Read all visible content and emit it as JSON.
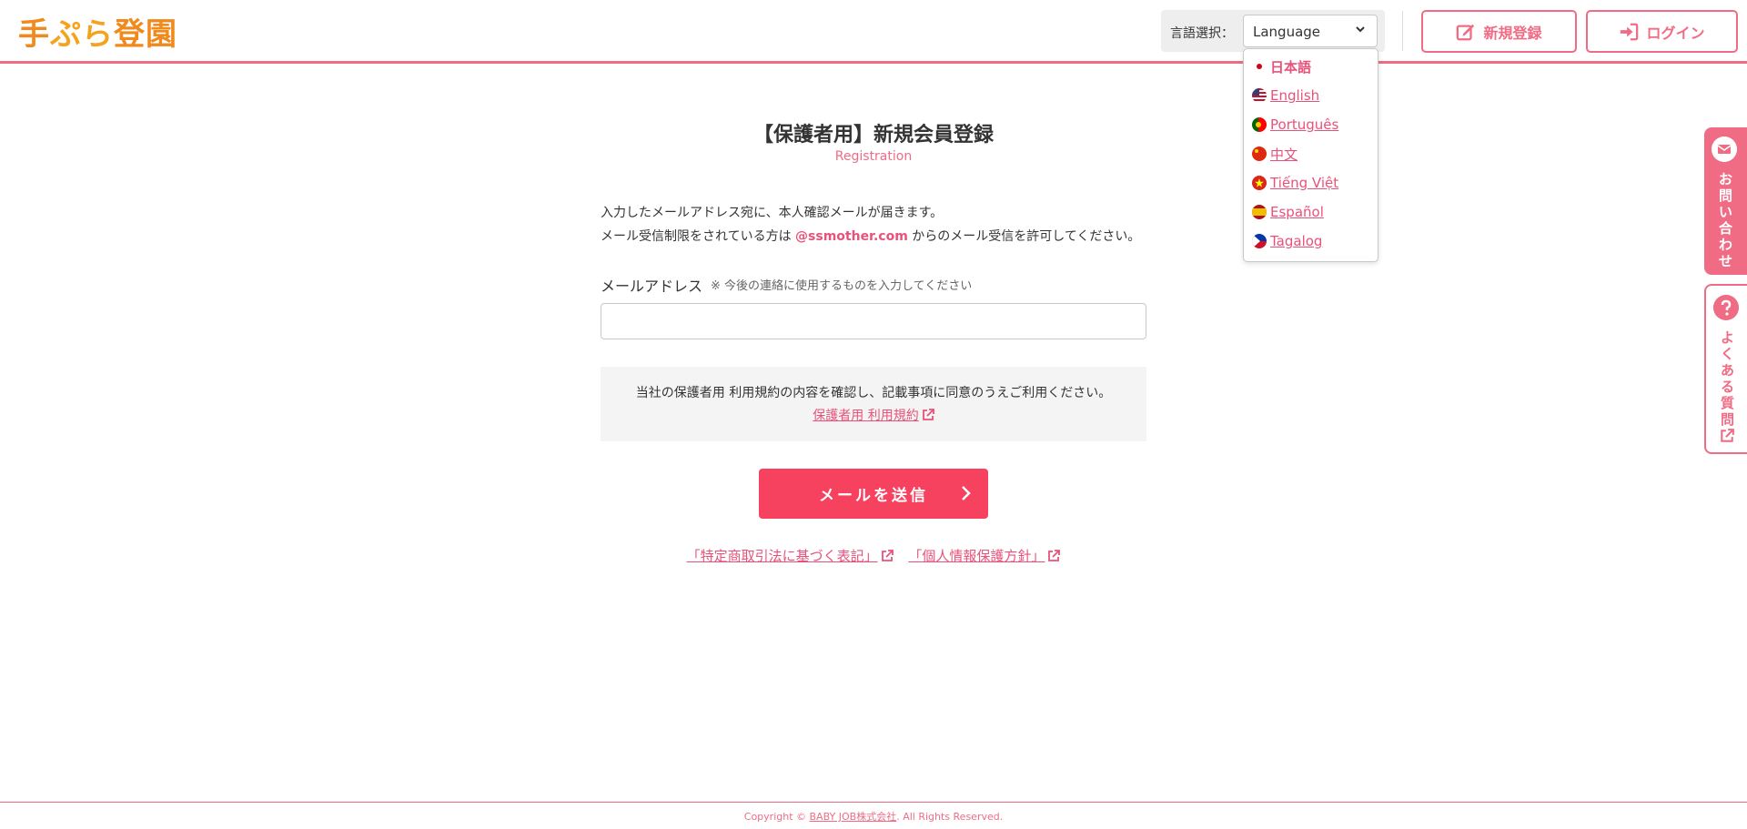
{
  "brand": {
    "logo_text_a": "手",
    "logo_text_b": "ぷら",
    "logo_text_c": "登園"
  },
  "header": {
    "language_label": "言語選択：",
    "language_select_value": "Language",
    "register_label": "新規登録",
    "login_label": "ログイン"
  },
  "language_menu": {
    "items": [
      {
        "label": "日本語",
        "flag": "jp"
      },
      {
        "label": "English",
        "flag": "us"
      },
      {
        "label": "Português",
        "flag": "pt"
      },
      {
        "label": "中文",
        "flag": "cn"
      },
      {
        "label": "Tiếng Việt",
        "flag": "vn"
      },
      {
        "label": "Español",
        "flag": "es"
      },
      {
        "label": "Tagalog",
        "flag": "ph"
      }
    ]
  },
  "main": {
    "title": "【保護者用】新規会員登録",
    "subtitle": "Registration",
    "intro_line1": "入力したメールアドレス宛に、本人確認メールが届きます。",
    "intro_line2_pre": "メール受信制限をされている方は ",
    "intro_domain": "@ssmother.com",
    "intro_line2_post": " からのメール受信を許可してください。",
    "email_label": "メールアドレス",
    "email_note": "※ 今後の連絡に使用するものを入力してください",
    "email_value": "",
    "terms_text": "当社の保護者用 利用規約の内容を確認し、記載事項に同意のうえご利用ください。",
    "terms_link": "保護者用 利用規約",
    "submit_label": "メールを送信",
    "legal_link_1": "「特定商取引法に基づく表記」",
    "legal_link_2": "「個人情報保護方針」"
  },
  "side": {
    "contact_chars": [
      "お",
      "問",
      "い",
      "合",
      "わ",
      "せ"
    ],
    "faq_chars": [
      "よ",
      "く",
      "あ",
      "る",
      "質",
      "問"
    ]
  },
  "footer": {
    "copyright_pre": "Copyright © ",
    "company": "BABY JOB株式会社",
    "copyright_post": ". All Rights Reserved."
  },
  "colors": {
    "accent": "#f06c85",
    "link": "#e8527a",
    "submit": "#f6415f",
    "logo": "#f08a1c"
  }
}
